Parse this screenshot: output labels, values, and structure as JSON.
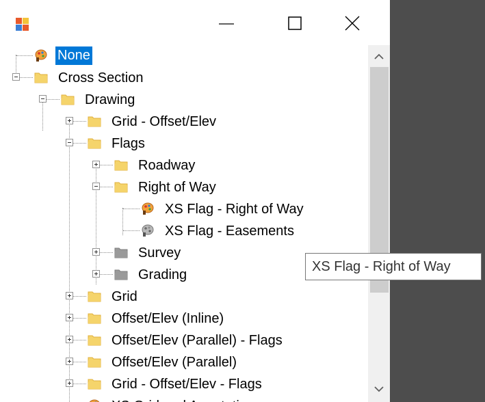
{
  "window": {
    "icon": "app-icon",
    "controls": {
      "minimize": "minimize-icon",
      "maximize": "maximize-icon",
      "close": "close-icon"
    }
  },
  "tree": {
    "items": [
      {
        "label": "None",
        "level": 0,
        "icon": "flag-color-icon",
        "selected": true
      },
      {
        "label": "Cross Section",
        "level": 0,
        "icon": "folder-icon",
        "expander": "minus"
      },
      {
        "label": "Drawing",
        "level": 1,
        "icon": "folder-icon",
        "expander": "minus"
      },
      {
        "label": "Grid - Offset/Elev",
        "level": 2,
        "icon": "folder-icon",
        "expander": "plus"
      },
      {
        "label": "Flags",
        "level": 2,
        "icon": "folder-icon",
        "expander": "minus"
      },
      {
        "label": "Roadway",
        "level": 3,
        "icon": "folder-icon",
        "expander": "plus"
      },
      {
        "label": "Right of Way",
        "level": 3,
        "icon": "folder-icon",
        "expander": "minus"
      },
      {
        "label": "XS Flag - Right of Way",
        "level": 4,
        "icon": "flag-color-icon"
      },
      {
        "label": "XS Flag - Easements",
        "level": 4,
        "icon": "flag-gray-icon"
      },
      {
        "label": "Survey",
        "level": 3,
        "icon": "folder-gray-icon",
        "expander": "plus"
      },
      {
        "label": "Grading",
        "level": 3,
        "icon": "folder-gray-icon",
        "expander": "plus"
      },
      {
        "label": "Grid",
        "level": 2,
        "icon": "folder-icon",
        "expander": "plus"
      },
      {
        "label": "Offset/Elev (Inline)",
        "level": 2,
        "icon": "folder-icon",
        "expander": "plus"
      },
      {
        "label": "Offset/Elev (Parallel) - Flags",
        "level": 2,
        "icon": "folder-icon",
        "expander": "plus"
      },
      {
        "label": "Offset/Elev (Parallel)",
        "level": 2,
        "icon": "folder-icon",
        "expander": "plus"
      },
      {
        "label": "Grid - Offset/Elev - Flags",
        "level": 2,
        "icon": "folder-icon",
        "expander": "plus"
      },
      {
        "label": "XS Grid and Annotation",
        "level": 2,
        "icon": "flag-color-icon"
      }
    ]
  },
  "tooltip": {
    "text": "XS Flag - Right of Way"
  },
  "colors": {
    "selection": "#0078d7",
    "folder": "#f5d46b",
    "folder_gray": "#9a9a9a",
    "background_dark": "#4d4d4d"
  }
}
